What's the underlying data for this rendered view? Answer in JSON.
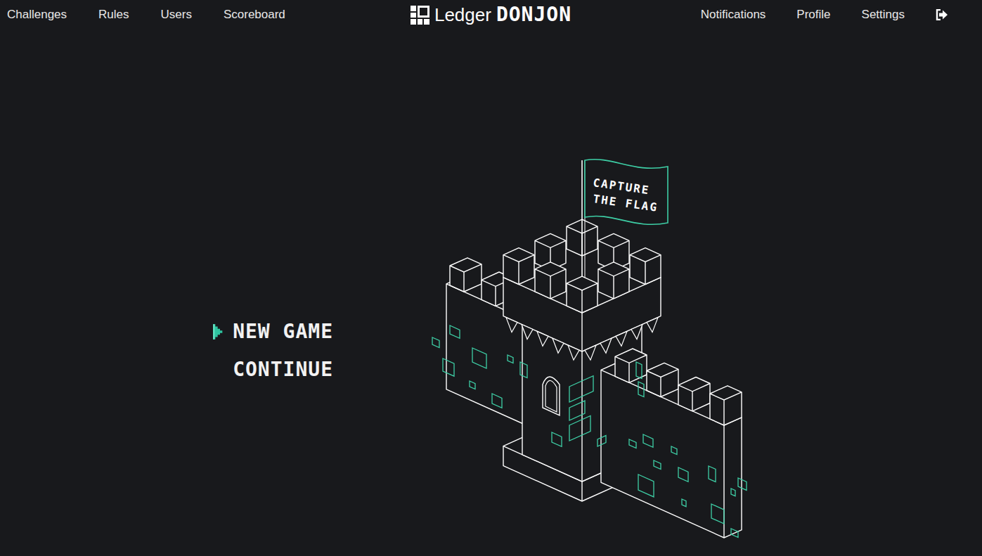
{
  "nav": {
    "left": [
      "Challenges",
      "Rules",
      "Users",
      "Scoreboard"
    ],
    "right": [
      "Notifications",
      "Profile",
      "Settings"
    ]
  },
  "logo": {
    "brand": "Ledger",
    "product": "DONJON"
  },
  "menu": [
    {
      "label": "NEW GAME",
      "selected": true
    },
    {
      "label": "CONTINUE",
      "selected": false
    }
  ],
  "flag": {
    "lines": [
      "CAPTURE",
      "THE FLAG"
    ]
  }
}
